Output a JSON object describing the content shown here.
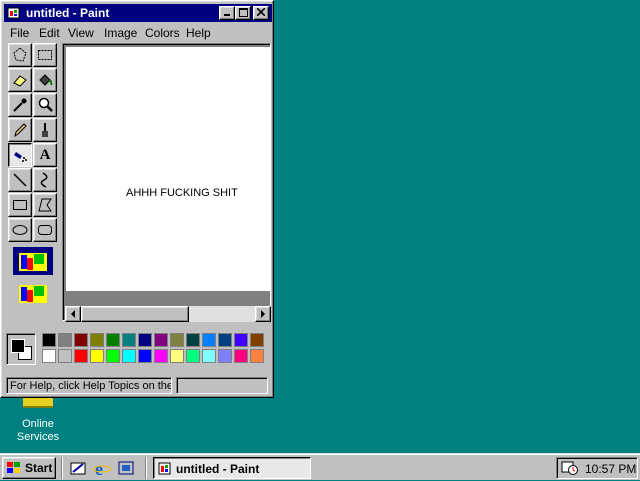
{
  "desktop": {
    "icon_label_line1": "Online",
    "icon_label_line2": "Services",
    "background_color": "#008080"
  },
  "window": {
    "title": "untitled - Paint",
    "menu": [
      "File",
      "Edit",
      "View",
      "Image",
      "Colors",
      "Help"
    ],
    "canvas_text": "AHHH FUCKING SHIT",
    "status_text": "For Help, click Help Topics on the Help Menu.",
    "tools": [
      "free-form-select-icon",
      "select-icon",
      "eraser-icon",
      "fill-with-color-icon",
      "pick-color-icon",
      "magnifier-icon",
      "pencil-icon",
      "brush-icon",
      "airbrush-icon",
      "text-icon",
      "line-icon",
      "curve-icon",
      "rectangle-icon",
      "polygon-icon",
      "ellipse-icon",
      "rounded-rectangle-icon"
    ],
    "text_tool_glyph": "A",
    "palette": {
      "foreground": "#000000",
      "background": "#ffffff",
      "row1": [
        "#000000",
        "#808080",
        "#800000",
        "#808000",
        "#008000",
        "#008080",
        "#000080",
        "#800080",
        "#808040",
        "#004040",
        "#0080ff",
        "#004080",
        "#4000ff",
        "#804000"
      ],
      "row2": [
        "#ffffff",
        "#c0c0c0",
        "#ff0000",
        "#ffff00",
        "#00ff00",
        "#00ffff",
        "#0000ff",
        "#ff00ff",
        "#ffff80",
        "#00ff80",
        "#80ffff",
        "#8080ff",
        "#ff0080",
        "#ff8040"
      ]
    }
  },
  "taskbar": {
    "start_label": "Start",
    "task_button_label": "untitled - Paint",
    "clock": "10:57 PM"
  }
}
